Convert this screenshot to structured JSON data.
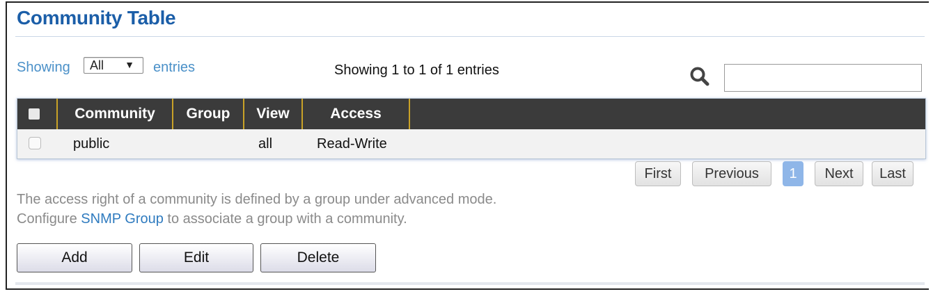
{
  "title": "Community Table",
  "controls": {
    "showing_prefix": "Showing",
    "entries_select": "All",
    "showing_suffix": "entries",
    "showing_info": "Showing 1 to 1 of 1 entries",
    "search_value": ""
  },
  "table": {
    "headers": [
      "Community",
      "Group",
      "View",
      "Access"
    ],
    "rows": [
      {
        "community": "public",
        "group": "",
        "view": "all",
        "access": "Read-Write"
      }
    ]
  },
  "pagination": {
    "first": "First",
    "previous": "Previous",
    "current_page": "1",
    "next": "Next",
    "last": "Last"
  },
  "note": {
    "line1": "The access right of a community is defined by a group under advanced mode.",
    "line2_prefix": "Configure",
    "line2_link": "SNMP Group",
    "line2_suffix": "to associate a group with a community."
  },
  "actions": {
    "add": "Add",
    "edit": "Edit",
    "delete": "Delete"
  },
  "colors": {
    "title": "#1b5ea8",
    "header_bg": "#3b3b3b",
    "header_divider": "#c9a227",
    "link": "#2f7bbf",
    "active_page": "#8fb6e8"
  }
}
